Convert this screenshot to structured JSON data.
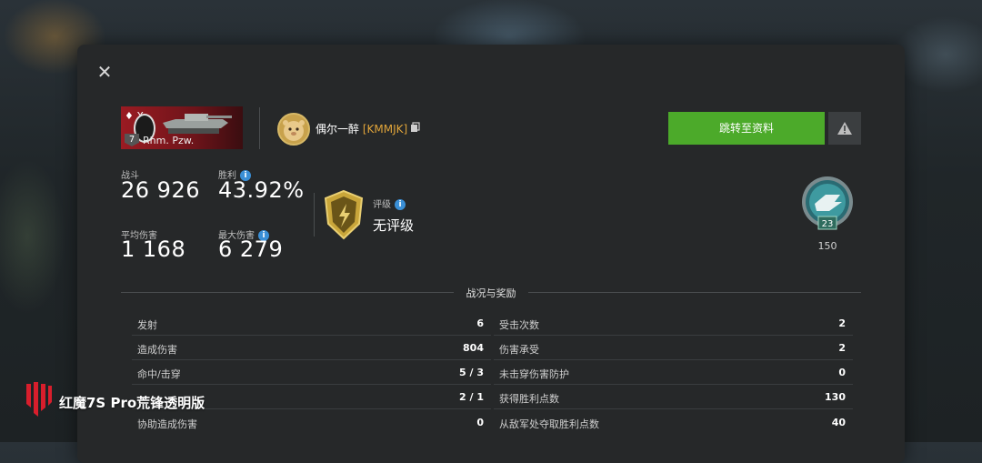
{
  "header": {
    "close_icon": "close-icon"
  },
  "tank": {
    "tier_mark": "♦ X",
    "level": "7",
    "name": "Rhm. Pzw."
  },
  "player": {
    "name": "偶尔一醉",
    "clan": "[KMMJK]",
    "copy_icon": "copy-icon"
  },
  "actions": {
    "profile_label": "跳转至资料",
    "report_icon": "warning-icon"
  },
  "stats": {
    "battles_label": "战斗",
    "battles": "26 926",
    "winrate_label": "胜利",
    "winrate": "43.92%",
    "avg_damage_label": "平均伤害",
    "avg_damage": "1 168",
    "max_damage_label": "最大伤害",
    "max_damage": "6 279"
  },
  "rating": {
    "label": "评级",
    "value": "无评级"
  },
  "medal": {
    "level": "23",
    "count": "150"
  },
  "section": {
    "title": "战况与奖励"
  },
  "left_table": [
    {
      "label": "发射",
      "value": "6"
    },
    {
      "label": "造成伤害",
      "value": "804"
    },
    {
      "label": "命中/击穿",
      "value": "5 / 3"
    },
    {
      "label": "",
      "value": "2 / 1"
    },
    {
      "label": "协助造成伤害",
      "value": "0"
    }
  ],
  "right_table": [
    {
      "label": "受击次数",
      "value": "2"
    },
    {
      "label": "伤害承受",
      "value": "2"
    },
    {
      "label": "未击穿伤害防护",
      "value": "0"
    },
    {
      "label": "获得胜利点数",
      "value": "130"
    },
    {
      "label": "从敌军处夺取胜利点数",
      "value": "40"
    }
  ],
  "watermark": {
    "text": "红魔7S Pro荒锋透明版"
  },
  "colors": {
    "accent_green": "#4caa2a",
    "clan_orange": "#e0a43a",
    "info_blue": "#3a8fd6",
    "badge_red": "#9a1b22"
  }
}
